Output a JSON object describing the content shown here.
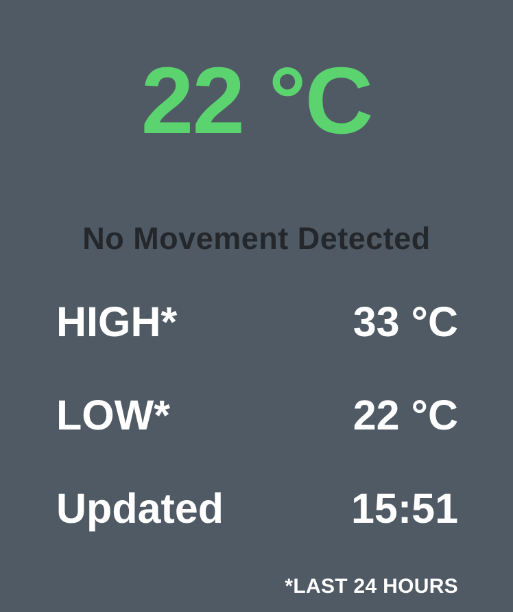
{
  "current": {
    "temperature": "22 °C",
    "color": "#5bd36e"
  },
  "status": {
    "motion": "No Movement Detected"
  },
  "stats": [
    {
      "label": "HIGH*",
      "value": "33 °C"
    },
    {
      "label": "LOW*",
      "value": "22 °C"
    },
    {
      "label": "Updated",
      "value": "15:51"
    }
  ],
  "footnote": "*LAST 24 HOURS",
  "colors": {
    "background": "#4f5a64",
    "text": "#ffffff",
    "status_text": "#24272b"
  }
}
